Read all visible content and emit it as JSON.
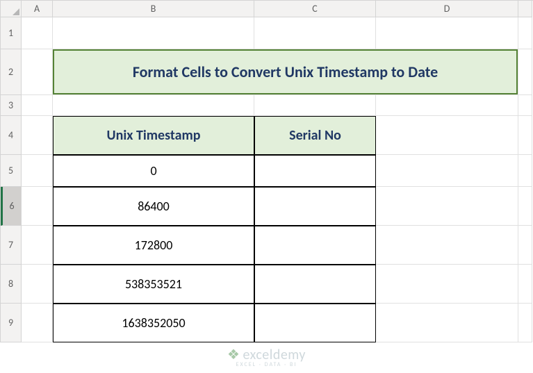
{
  "columns": [
    "A",
    "B",
    "C",
    "D",
    ""
  ],
  "rows": [
    "1",
    "2",
    "3",
    "4",
    "5",
    "6",
    "7",
    "8",
    "9"
  ],
  "selected_row_index": 5,
  "title": "Format Cells to Convert Unix Timestamp to Date",
  "table": {
    "headers": [
      "Unix Timestamp",
      "Serial No"
    ],
    "data": [
      {
        "ts": "0",
        "sn": ""
      },
      {
        "ts": "86400",
        "sn": ""
      },
      {
        "ts": "172800",
        "sn": ""
      },
      {
        "ts": "538353521",
        "sn": ""
      },
      {
        "ts": "1638352050",
        "sn": ""
      }
    ]
  },
  "watermark": {
    "main": "exceldemy",
    "sub": "EXCEL · DATA · BI"
  },
  "chart_data": {
    "type": "table",
    "title": "Format Cells to Convert Unix Timestamp to Date",
    "columns": [
      "Unix Timestamp",
      "Serial No"
    ],
    "rows": [
      [
        0,
        null
      ],
      [
        86400,
        null
      ],
      [
        172800,
        null
      ],
      [
        538353521,
        null
      ],
      [
        1638352050,
        null
      ]
    ]
  }
}
